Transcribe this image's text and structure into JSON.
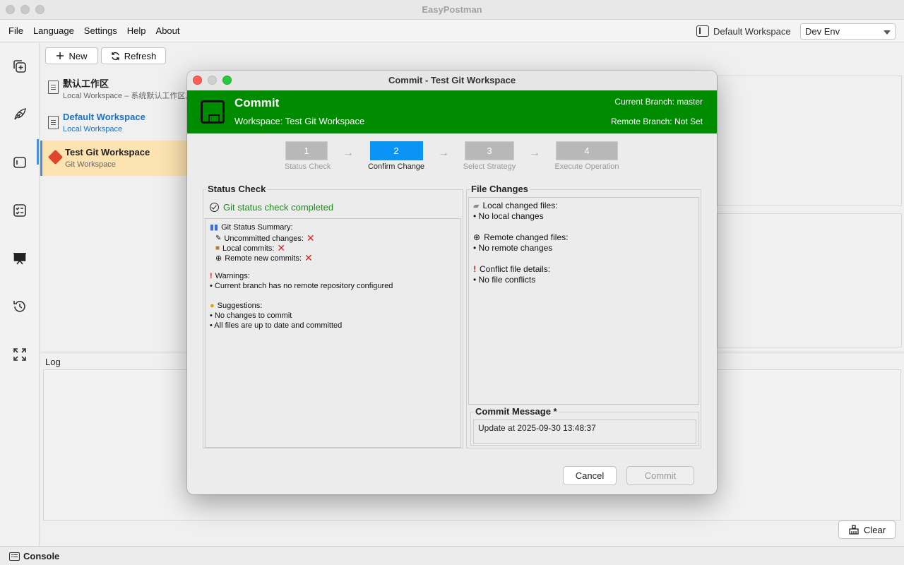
{
  "app": {
    "title": "EasyPostman",
    "menu": [
      "File",
      "Language",
      "Settings",
      "Help",
      "About"
    ],
    "workspace_indicator": "Default Workspace",
    "env_select": "Dev Env"
  },
  "toolbar": {
    "new_label": "New",
    "refresh_label": "Refresh"
  },
  "workspaces": [
    {
      "name": "默认工作区",
      "sub": "Local Workspace – 系统默认工作区, 不",
      "icon": "document-icon"
    },
    {
      "name": "Default Workspace",
      "sub": "Local Workspace",
      "icon": "document-icon"
    },
    {
      "name": "Test Git Workspace",
      "sub": "Git Workspace",
      "icon": "git-icon"
    }
  ],
  "log": {
    "label": "Log",
    "clear_label": "Clear"
  },
  "statusbar": {
    "console_label": "Console"
  },
  "dialog": {
    "title": "Commit - Test Git Workspace",
    "banner_title": "Commit",
    "workspace_line": "Workspace: Test Git Workspace",
    "current_branch": "Current Branch: master",
    "remote_branch": "Remote Branch: Not Set",
    "steps": [
      {
        "num": "1",
        "label": "Status Check"
      },
      {
        "num": "2",
        "label": "Confirm Change"
      },
      {
        "num": "3",
        "label": "Select Strategy"
      },
      {
        "num": "4",
        "label": "Execute Operation"
      }
    ],
    "status_check": {
      "title": "Status Check",
      "completed": "Git status check completed",
      "summary_title": "Git Status Summary:",
      "uncommitted": "Uncommitted changes:",
      "local_commits": "Local commits:",
      "remote_commits": "Remote new commits:",
      "warnings_title": "Warnings:",
      "warning_1": "• Current branch has no remote repository configured",
      "suggestions_title": "Suggestions:",
      "suggestion_1": "• No changes to commit",
      "suggestion_2": "• All files are up to date and committed"
    },
    "file_changes": {
      "title": "File Changes",
      "local_title": "Local changed files:",
      "local_value": "• No local changes",
      "remote_title": "Remote changed files:",
      "remote_value": "• No remote changes",
      "conflict_title": "Conflict file details:",
      "conflict_value": "• No file conflicts"
    },
    "commit_message": {
      "label": "Commit Message *",
      "value": "Update at 2025-09-30 13:48:37"
    },
    "cancel_label": "Cancel",
    "commit_label": "Commit"
  },
  "colors": {
    "banner": "#008c00",
    "active_step": "#0a94f4",
    "selected_ws": "#fde3b0",
    "error_x": "#e02020"
  }
}
